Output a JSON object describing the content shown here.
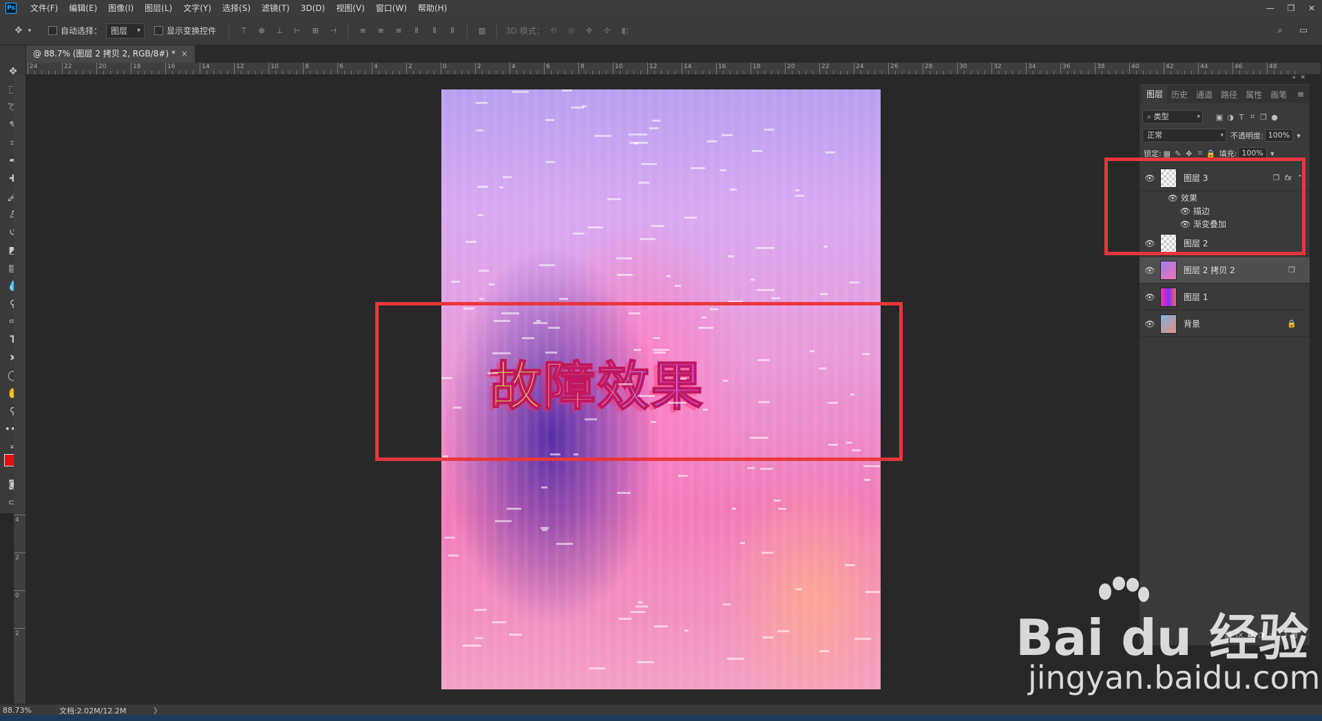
{
  "app": {
    "logo": "Ps"
  },
  "menu": [
    "文件(F)",
    "编辑(E)",
    "图像(I)",
    "图层(L)",
    "文字(Y)",
    "选择(S)",
    "滤镜(T)",
    "3D(D)",
    "视图(V)",
    "窗口(W)",
    "帮助(H)"
  ],
  "window_controls": {
    "minimize": "—",
    "restore": "❐",
    "close": "✕"
  },
  "options": {
    "auto_select_label": "自动选择：",
    "auto_select_value": "图层",
    "show_transform_label": "显示变换控件",
    "mode_3d_label": "3D 模式："
  },
  "document_tab": {
    "title": "@ 88.7% (图层 2 拷贝 2, RGB/8#) *",
    "close": "×"
  },
  "ruler_h": [
    "24",
    "22",
    "20",
    "18",
    "16",
    "14",
    "12",
    "10",
    "8",
    "6",
    "4",
    "2",
    "0",
    "2",
    "4",
    "6",
    "8",
    "10",
    "12",
    "14",
    "16",
    "18",
    "20",
    "22",
    "24",
    "26",
    "28",
    "30",
    "32",
    "34",
    "36",
    "38",
    "40",
    "42",
    "44",
    "46",
    "48"
  ],
  "ruler_v": [
    "4",
    "2",
    "0",
    "2"
  ],
  "canvas": {
    "artwork_text": "故障效果"
  },
  "layers_panel": {
    "tabs": [
      "图层",
      "历史",
      "通道",
      "路径",
      "属性",
      "画笔"
    ],
    "filter_kind": "类型",
    "blend_mode": "正常",
    "opacity_label": "不透明度:",
    "opacity_value": "100%",
    "lock_label": "锁定:",
    "fill_label": "填充:",
    "fill_value": "100%",
    "layers": [
      {
        "name": "图层 3",
        "fx": "fx"
      },
      {
        "name": "图层 2"
      },
      {
        "name": "图层 2 拷贝 2"
      },
      {
        "name": "图层 1"
      },
      {
        "name": "背景"
      }
    ],
    "effects": {
      "label": "效果",
      "items": [
        "描边",
        "渐变叠加"
      ]
    }
  },
  "status": {
    "zoom": "88.73%",
    "doc": "文档:2.02M/12.2M",
    "arrow": "〉"
  },
  "watermark": {
    "logo": "Bai du 经验",
    "url": "jingyan.baidu.com"
  }
}
